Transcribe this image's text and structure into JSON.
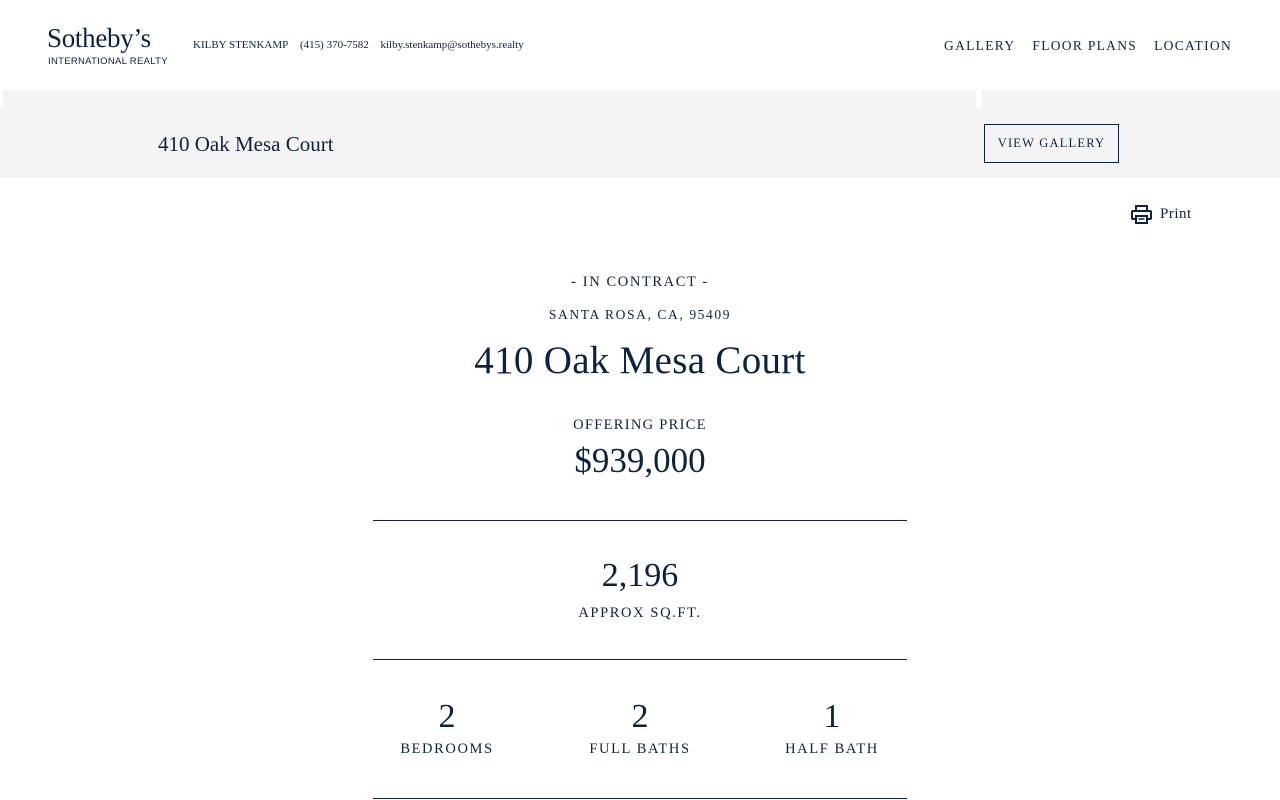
{
  "header": {
    "logo_main": "Sotheby’s",
    "logo_sub": "INTERNATIONAL REALTY",
    "agent_name": "KILBY STENKAMP",
    "agent_phone": "(415) 370-7582",
    "agent_email": "kilby.stenkamp@sothebys.realty",
    "nav": [
      "GALLERY",
      "FLOOR PLANS",
      "LOCATION"
    ]
  },
  "subbar": {
    "title": "410 Oak Mesa Court",
    "view_gallery": "VIEW GALLERY"
  },
  "print": {
    "label": "Print",
    "icon": "printer-icon"
  },
  "listing": {
    "status": "- IN CONTRACT -",
    "city": "SANTA ROSA, CA, 95409",
    "address": "410 Oak Mesa Court",
    "price_label": "OFFERING PRICE",
    "price": "$939,000",
    "sqft_value": "2,196",
    "sqft_label": "APPROX SQ.FT.",
    "stats": [
      {
        "value": "2",
        "label": "BEDROOMS"
      },
      {
        "value": "2",
        "label": "FULL BATHS"
      },
      {
        "value": "1",
        "label": "HALF BATH"
      }
    ]
  },
  "colors": {
    "brand_navy": "#0c2340",
    "subbar_bg": "#f4f4f4"
  }
}
